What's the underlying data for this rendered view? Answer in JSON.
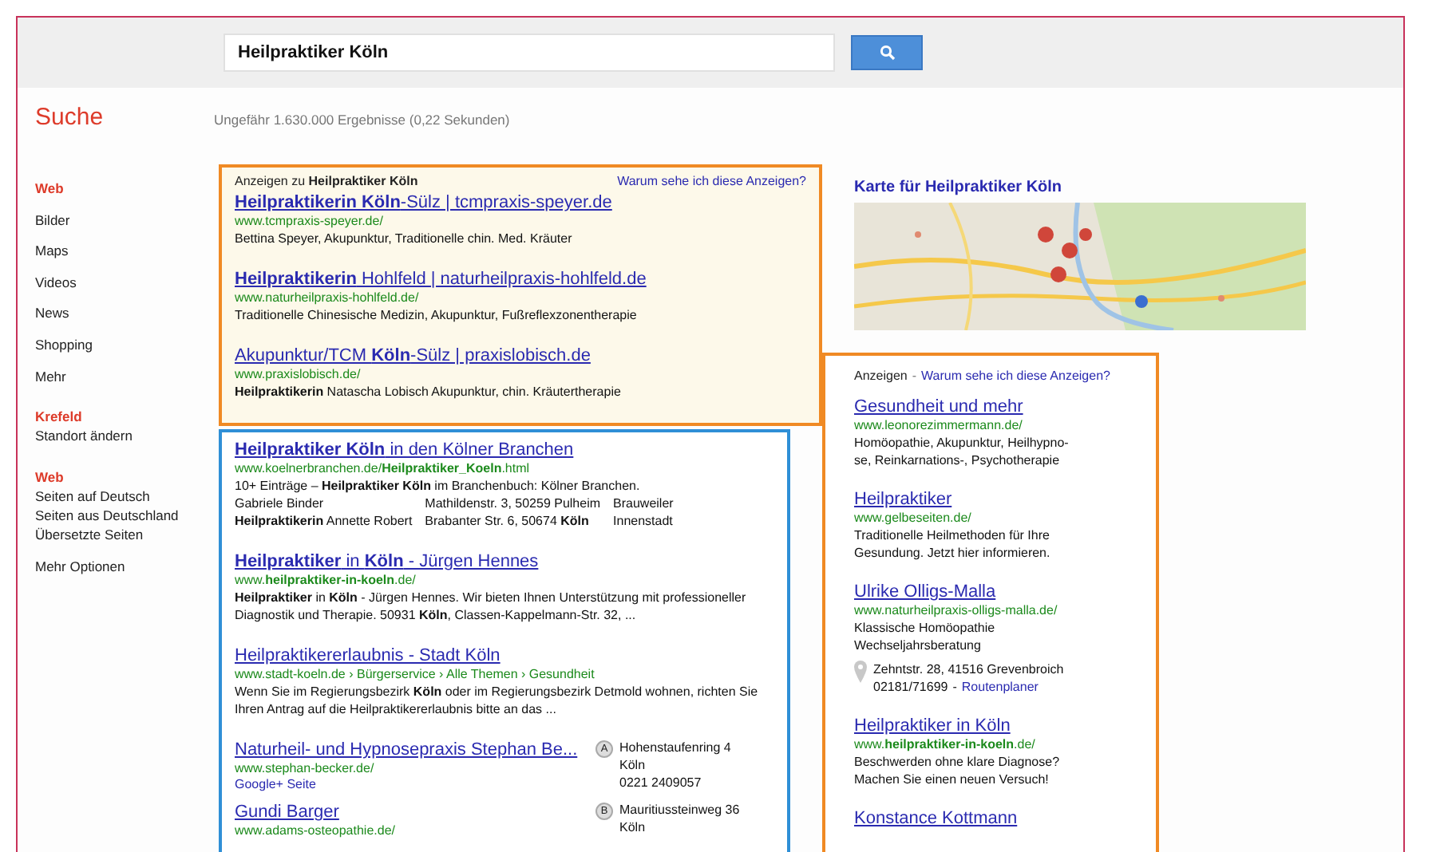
{
  "search": {
    "value": "Heilpraktiker Köln"
  },
  "brand": "Suche",
  "result_stats": "Ungefähr 1.630.000 Ergebnisse (0,22 Sekunden)",
  "sidebar": {
    "types": [
      {
        "label": "Web",
        "selected": true
      },
      {
        "label": "Bilder",
        "selected": false
      },
      {
        "label": "Maps",
        "selected": false
      },
      {
        "label": "Videos",
        "selected": false
      },
      {
        "label": "News",
        "selected": false
      },
      {
        "label": "Shopping",
        "selected": false
      },
      {
        "label": "Mehr",
        "selected": false
      }
    ],
    "location": {
      "heading": "Krefeld",
      "link": "Standort ändern"
    },
    "filters": {
      "heading": "Web",
      "items": [
        "Seiten auf Deutsch",
        "Seiten aus Deutschland",
        "Übersetzte Seiten"
      ]
    },
    "more_options": "Mehr Optionen"
  },
  "top_ads": {
    "heading": "Anzeigen zu **Heilpraktiker Köln**",
    "why_link": "Warum sehe ich diese Anzeigen?",
    "ads": [
      {
        "title": "**Heilpraktikerin Köln**-Sülz | tcmpraxis-speyer.de",
        "url": "www.tcmpraxis-speyer.de/",
        "description": "Bettina Speyer, Akupunktur, Traditionelle chin. Med. Kräuter"
      },
      {
        "title": "**Heilpraktikerin** Hohlfeld | naturheilpraxis-hohlfeld.de",
        "url": "www.naturheilpraxis-hohlfeld.de/",
        "description": "Traditionelle Chinesische Medizin, Akupunktur, Fußreflexzonentherapie"
      },
      {
        "title": "Akupunktur/TCM **Köln**-Sülz | praxislobisch.de",
        "url": "www.praxislobisch.de/",
        "description": "**Heilpraktikerin** Natascha Lobisch Akupunktur, chin. Kräutertherapie"
      }
    ]
  },
  "results": [
    {
      "kind": "table",
      "title": "**Heilpraktiker Köln** in den Kölner Branchen",
      "url": "www.koelnerbranchen.de/**Heilpraktiker_Koeln**.html",
      "description": "10+ Einträge – **Heilpraktiker Köln** im Branchenbuch: Kölner Branchen.",
      "rows": [
        [
          "Gabriele Binder",
          "Mathildenstr. 3, 50259 Pulheim",
          "Brauweiler"
        ],
        [
          "**Heilpraktikerin** Annette Robert",
          "Brabanter Str. 6, 50674 **Köln**",
          "Innenstadt"
        ]
      ]
    },
    {
      "kind": "plain",
      "title": "**Heilpraktiker** in **Köln** - Jürgen Hennes",
      "url": "www.**heilpraktiker-in-koeln**.de/",
      "description": "**Heilpraktiker** in **Köln** - Jürgen Hennes. Wir bieten Ihnen Unterstützung mit professioneller Diagnostik und Therapie. 50931 **Köln**, Classen-Kappelmann-Str. 32, ..."
    },
    {
      "kind": "plain",
      "title": "Heilpraktikererlaubnis - Stadt Köln",
      "url": "www.stadt-koeln.de › Bürgerservice › Alle Themen › Gesundheit",
      "description": "Wenn Sie im Regierungsbezirk **Köln** oder im Regierungsbezirk Detmold wohnen, richten Sie Ihren Antrag auf die Heilpraktikererlaubnis bitte an das ..."
    },
    {
      "kind": "local",
      "title": "Naturheil- und Hypnosepraxis Stephan Be...",
      "url": "www.stephan-becker.de/",
      "extra_link": "Google+ Seite",
      "marker": "A",
      "address": [
        "Hohenstaufenring 4",
        "Köln",
        "0221 2409057"
      ]
    },
    {
      "kind": "local",
      "title": "Gundi Barger",
      "url": "www.adams-osteopathie.de/",
      "marker": "B",
      "address": [
        "Mauritiussteinweg 36",
        "Köln"
      ]
    }
  ],
  "map": {
    "title": "Karte für Heilpraktiker Köln"
  },
  "side_ads": {
    "label": "Anzeigen",
    "separator": "-",
    "why_link": "Warum sehe ich diese Anzeigen?",
    "ads": [
      {
        "title": "Gesundheit und mehr",
        "url": "www.leonorezimmermann.de/",
        "lines": [
          "Homöopathie, Akupunktur, Heilhypno-",
          "se, Reinkarnations-, Psychotherapie"
        ]
      },
      {
        "title": "Heilpraktiker",
        "url": "www.gelbeseiten.de/",
        "lines": [
          "Traditionelle Heilmethoden für Ihre",
          "Gesundung. Jetzt hier informieren."
        ]
      },
      {
        "title": "Ulrike Olligs-Malla",
        "url": "www.naturheilpraxis-olligs-malla.de/",
        "lines": [
          "Klassische Homöopathie",
          "Wechseljahrsberatung"
        ],
        "place": {
          "address": "Zehntstr. 28, 41516 Grevenbroich",
          "phone": "02181/71699",
          "separator": "-",
          "route_link": "Routenplaner"
        }
      },
      {
        "title": "Heilpraktiker in Köln",
        "url": "www.**heilpraktiker-in-koeln**.de/",
        "lines": [
          "Beschwerden ohne klare Diagnose?",
          "Machen Sie einen neuen Versuch!"
        ]
      },
      {
        "title": "Konstance Kottmann"
      }
    ]
  }
}
